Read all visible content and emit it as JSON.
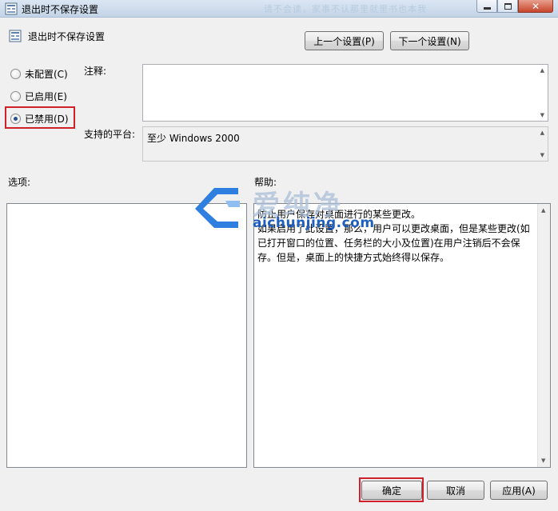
{
  "window": {
    "title": "退出时不保存设置",
    "title_bg_text": "请不会读，家事不认那里就里书也本我"
  },
  "header": {
    "setting_name": "退出时不保存设置",
    "prev_button": "上一个设置(P)",
    "next_button": "下一个设置(N)"
  },
  "state": {
    "options": [
      {
        "label": "未配置(C)",
        "selected": false
      },
      {
        "label": "已启用(E)",
        "selected": false
      },
      {
        "label": "已禁用(D)",
        "selected": true
      }
    ]
  },
  "comment": {
    "label": "注释:",
    "value": ""
  },
  "platform": {
    "label": "支持的平台:",
    "value": "至少 Windows 2000"
  },
  "options_section": {
    "label": "选项:"
  },
  "help_section": {
    "label": "帮助:",
    "paragraphs": [
      "防止用户保存对桌面进行的某些更改。",
      "如果启用了此设置，那么，用户可以更改桌面，但是某些更改(如已打开窗口的位置、任务栏的大小及位置)在用户注销后不会保存。但是，桌面上的快捷方式始终得以保存。"
    ]
  },
  "watermark": {
    "text_cn": "爱纯净",
    "url": "aichunjing.com"
  },
  "footer": {
    "ok": "确定",
    "cancel": "取消",
    "apply": "应用(A)"
  },
  "colors": {
    "highlight": "#d0202a",
    "title_bar": "#c3d4e7",
    "watermark_blue": "#1e5fbf"
  },
  "icons": {
    "app": "policy-settings-icon",
    "minimize": "minimize-icon",
    "maximize": "maximize-icon",
    "close": "close-icon"
  }
}
